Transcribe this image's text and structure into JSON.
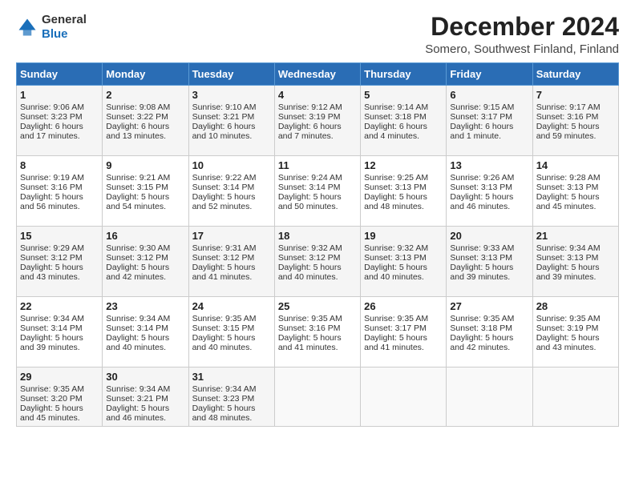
{
  "header": {
    "logo_line1": "General",
    "logo_line2": "Blue",
    "title": "December 2024",
    "subtitle": "Somero, Southwest Finland, Finland"
  },
  "calendar": {
    "headers": [
      "Sunday",
      "Monday",
      "Tuesday",
      "Wednesday",
      "Thursday",
      "Friday",
      "Saturday"
    ],
    "rows": [
      [
        {
          "day": "1",
          "sunrise": "Sunrise: 9:06 AM",
          "sunset": "Sunset: 3:23 PM",
          "daylight": "Daylight: 6 hours and 17 minutes."
        },
        {
          "day": "2",
          "sunrise": "Sunrise: 9:08 AM",
          "sunset": "Sunset: 3:22 PM",
          "daylight": "Daylight: 6 hours and 13 minutes."
        },
        {
          "day": "3",
          "sunrise": "Sunrise: 9:10 AM",
          "sunset": "Sunset: 3:21 PM",
          "daylight": "Daylight: 6 hours and 10 minutes."
        },
        {
          "day": "4",
          "sunrise": "Sunrise: 9:12 AM",
          "sunset": "Sunset: 3:19 PM",
          "daylight": "Daylight: 6 hours and 7 minutes."
        },
        {
          "day": "5",
          "sunrise": "Sunrise: 9:14 AM",
          "sunset": "Sunset: 3:18 PM",
          "daylight": "Daylight: 6 hours and 4 minutes."
        },
        {
          "day": "6",
          "sunrise": "Sunrise: 9:15 AM",
          "sunset": "Sunset: 3:17 PM",
          "daylight": "Daylight: 6 hours and 1 minute."
        },
        {
          "day": "7",
          "sunrise": "Sunrise: 9:17 AM",
          "sunset": "Sunset: 3:16 PM",
          "daylight": "Daylight: 5 hours and 59 minutes."
        }
      ],
      [
        {
          "day": "8",
          "sunrise": "Sunrise: 9:19 AM",
          "sunset": "Sunset: 3:16 PM",
          "daylight": "Daylight: 5 hours and 56 minutes."
        },
        {
          "day": "9",
          "sunrise": "Sunrise: 9:21 AM",
          "sunset": "Sunset: 3:15 PM",
          "daylight": "Daylight: 5 hours and 54 minutes."
        },
        {
          "day": "10",
          "sunrise": "Sunrise: 9:22 AM",
          "sunset": "Sunset: 3:14 PM",
          "daylight": "Daylight: 5 hours and 52 minutes."
        },
        {
          "day": "11",
          "sunrise": "Sunrise: 9:24 AM",
          "sunset": "Sunset: 3:14 PM",
          "daylight": "Daylight: 5 hours and 50 minutes."
        },
        {
          "day": "12",
          "sunrise": "Sunrise: 9:25 AM",
          "sunset": "Sunset: 3:13 PM",
          "daylight": "Daylight: 5 hours and 48 minutes."
        },
        {
          "day": "13",
          "sunrise": "Sunrise: 9:26 AM",
          "sunset": "Sunset: 3:13 PM",
          "daylight": "Daylight: 5 hours and 46 minutes."
        },
        {
          "day": "14",
          "sunrise": "Sunrise: 9:28 AM",
          "sunset": "Sunset: 3:13 PM",
          "daylight": "Daylight: 5 hours and 45 minutes."
        }
      ],
      [
        {
          "day": "15",
          "sunrise": "Sunrise: 9:29 AM",
          "sunset": "Sunset: 3:12 PM",
          "daylight": "Daylight: 5 hours and 43 minutes."
        },
        {
          "day": "16",
          "sunrise": "Sunrise: 9:30 AM",
          "sunset": "Sunset: 3:12 PM",
          "daylight": "Daylight: 5 hours and 42 minutes."
        },
        {
          "day": "17",
          "sunrise": "Sunrise: 9:31 AM",
          "sunset": "Sunset: 3:12 PM",
          "daylight": "Daylight: 5 hours and 41 minutes."
        },
        {
          "day": "18",
          "sunrise": "Sunrise: 9:32 AM",
          "sunset": "Sunset: 3:12 PM",
          "daylight": "Daylight: 5 hours and 40 minutes."
        },
        {
          "day": "19",
          "sunrise": "Sunrise: 9:32 AM",
          "sunset": "Sunset: 3:13 PM",
          "daylight": "Daylight: 5 hours and 40 minutes."
        },
        {
          "day": "20",
          "sunrise": "Sunrise: 9:33 AM",
          "sunset": "Sunset: 3:13 PM",
          "daylight": "Daylight: 5 hours and 39 minutes."
        },
        {
          "day": "21",
          "sunrise": "Sunrise: 9:34 AM",
          "sunset": "Sunset: 3:13 PM",
          "daylight": "Daylight: 5 hours and 39 minutes."
        }
      ],
      [
        {
          "day": "22",
          "sunrise": "Sunrise: 9:34 AM",
          "sunset": "Sunset: 3:14 PM",
          "daylight": "Daylight: 5 hours and 39 minutes."
        },
        {
          "day": "23",
          "sunrise": "Sunrise: 9:34 AM",
          "sunset": "Sunset: 3:14 PM",
          "daylight": "Daylight: 5 hours and 40 minutes."
        },
        {
          "day": "24",
          "sunrise": "Sunrise: 9:35 AM",
          "sunset": "Sunset: 3:15 PM",
          "daylight": "Daylight: 5 hours and 40 minutes."
        },
        {
          "day": "25",
          "sunrise": "Sunrise: 9:35 AM",
          "sunset": "Sunset: 3:16 PM",
          "daylight": "Daylight: 5 hours and 41 minutes."
        },
        {
          "day": "26",
          "sunrise": "Sunrise: 9:35 AM",
          "sunset": "Sunset: 3:17 PM",
          "daylight": "Daylight: 5 hours and 41 minutes."
        },
        {
          "day": "27",
          "sunrise": "Sunrise: 9:35 AM",
          "sunset": "Sunset: 3:18 PM",
          "daylight": "Daylight: 5 hours and 42 minutes."
        },
        {
          "day": "28",
          "sunrise": "Sunrise: 9:35 AM",
          "sunset": "Sunset: 3:19 PM",
          "daylight": "Daylight: 5 hours and 43 minutes."
        }
      ],
      [
        {
          "day": "29",
          "sunrise": "Sunrise: 9:35 AM",
          "sunset": "Sunset: 3:20 PM",
          "daylight": "Daylight: 5 hours and 45 minutes."
        },
        {
          "day": "30",
          "sunrise": "Sunrise: 9:34 AM",
          "sunset": "Sunset: 3:21 PM",
          "daylight": "Daylight: 5 hours and 46 minutes."
        },
        {
          "day": "31",
          "sunrise": "Sunrise: 9:34 AM",
          "sunset": "Sunset: 3:23 PM",
          "daylight": "Daylight: 5 hours and 48 minutes."
        },
        null,
        null,
        null,
        null
      ]
    ]
  }
}
